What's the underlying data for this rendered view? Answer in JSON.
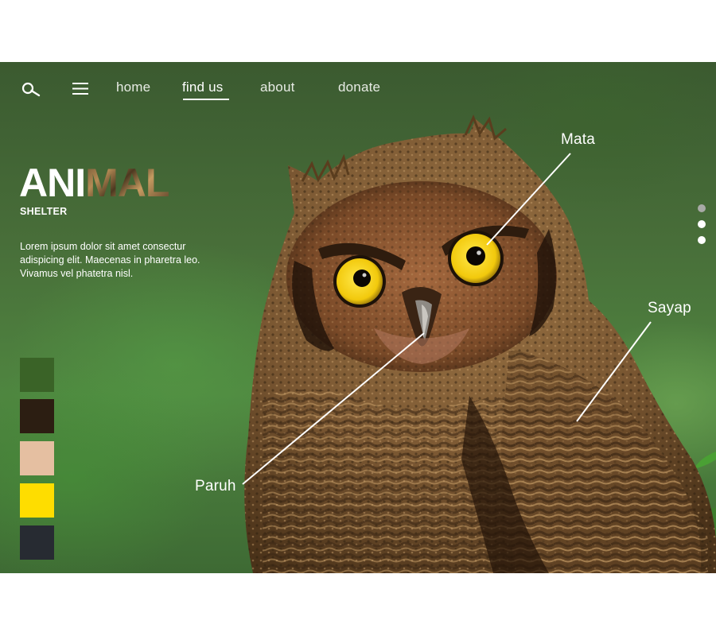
{
  "nav": {
    "items": [
      {
        "label": "home",
        "active": false
      },
      {
        "label": "find us",
        "active": true
      },
      {
        "label": "about",
        "active": false
      },
      {
        "label": "donate",
        "active": false
      }
    ],
    "search_icon": "search-icon",
    "menu_icon": "hamburger-menu-icon"
  },
  "brand": {
    "title_plain": "ANI",
    "title_textured": "MAL",
    "subtitle": "SHELTER"
  },
  "description": "Lorem ipsum dolor sit amet consectur adispicing elit. Maecenas in pharetra leo. Vivamus vel phatetra nisl.",
  "palette": [
    "#3a6327",
    "#2c1e12",
    "#e5bfa1",
    "#fedd00",
    "#272b32"
  ],
  "annotations": {
    "eye": "Mata",
    "wing": "Sayap",
    "beak": "Paruh"
  },
  "pager": {
    "count": 3,
    "active_index": 0
  },
  "colors": {
    "text": "#ffffff",
    "pager_active": "#a8aaa6",
    "owl_eye": "#f5d416"
  }
}
